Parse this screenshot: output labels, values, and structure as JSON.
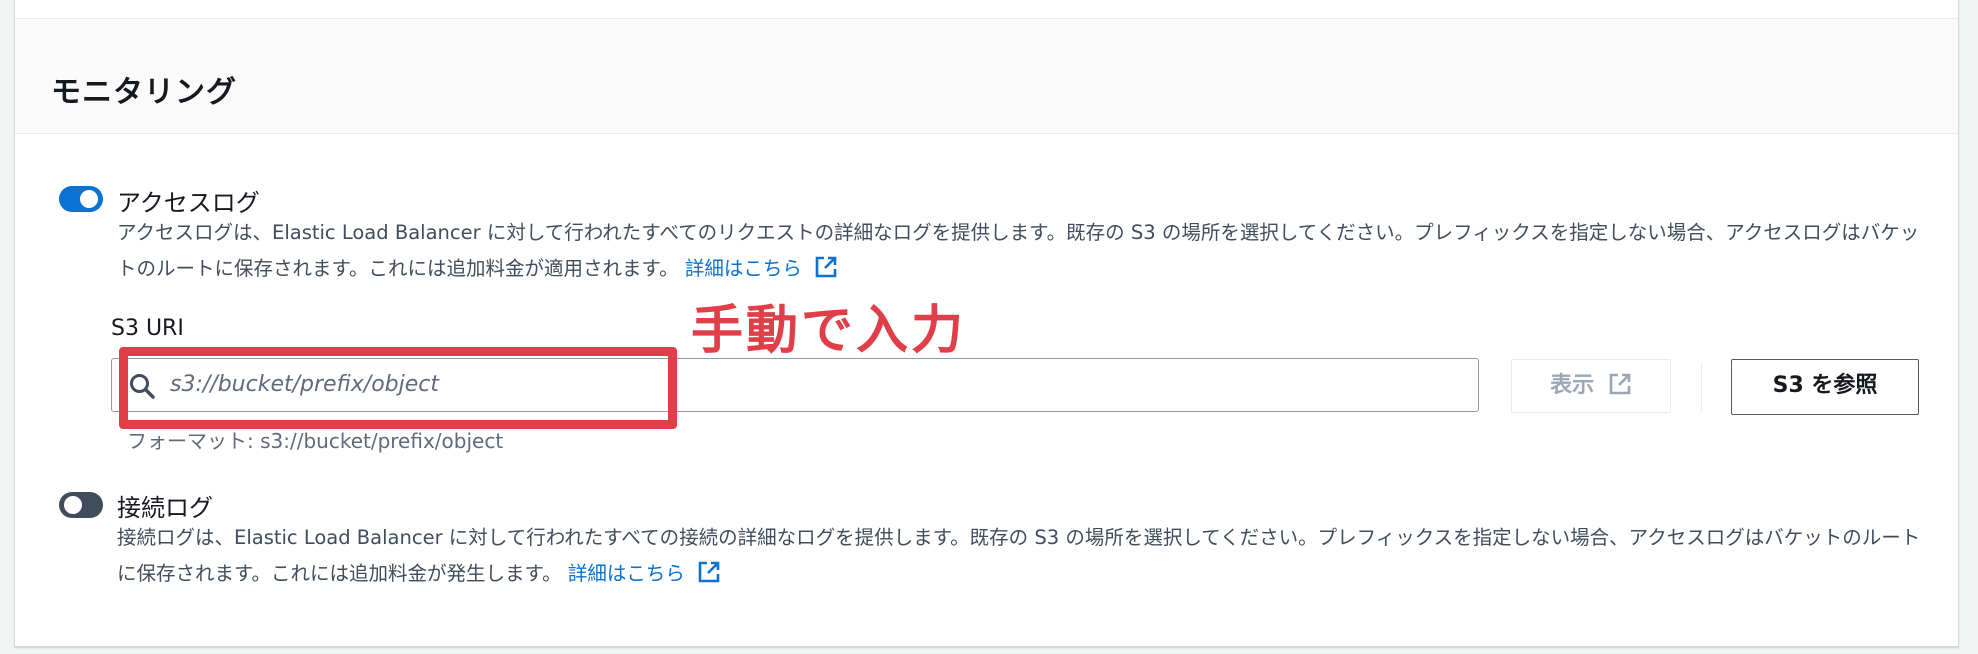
{
  "section": {
    "title": "モニタリング"
  },
  "access_logs": {
    "enabled": true,
    "label": "アクセスログ",
    "description": "アクセスログは、Elastic Load Balancer に対して行われたすべてのリクエストの詳細なログを提供します。既存の S3 の場所を選択してください。プレフィックスを指定しない場合、アクセスログはバケットのルートに保存されます。これには追加料金が適用されます。",
    "learn_more": "詳細はこちら",
    "s3_uri": {
      "label": "S3 URI",
      "placeholder": "s3://bucket/prefix/object",
      "value": "",
      "hint": "フォーマット: s3://bucket/prefix/object"
    },
    "view_button": "表示",
    "browse_button": "S3 を参照"
  },
  "connection_logs": {
    "enabled": false,
    "label": "接続ログ",
    "description": "接続ログは、Elastic Load Balancer に対して行われたすべての接続の詳細なログを提供します。既存の S3 の場所を選択してください。プレフィックスを指定しない場合、アクセスログはバケットのルートに保存されます。これには追加料金が発生します。",
    "learn_more": "詳細はこちら"
  },
  "annotation": {
    "text": "手動で入力",
    "color": "#e03f49"
  },
  "colors": {
    "link": "#0972d3",
    "toggle_on": "#0972d3",
    "toggle_off": "#414d5c"
  },
  "icons": {
    "external_link": "external-link-icon",
    "search": "search-icon"
  }
}
